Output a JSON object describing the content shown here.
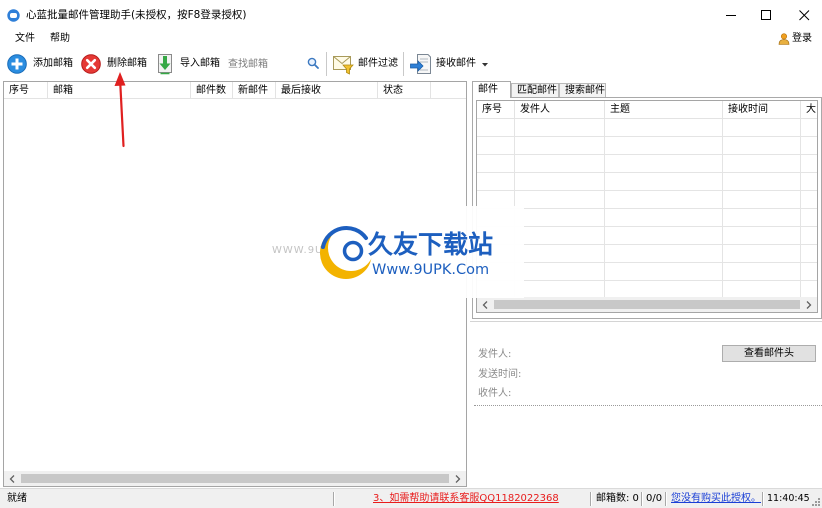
{
  "window": {
    "title": "心蓝批量邮件管理助手(未授权，按F8登录授权)",
    "app_icon": "app-icon",
    "controls": [
      "minimize-icon",
      "maximize-icon",
      "close-icon"
    ]
  },
  "menu": {
    "items": [
      {
        "label": "文件"
      },
      {
        "label": "帮助"
      }
    ],
    "login": {
      "label": "登录",
      "icon": "user-icon"
    }
  },
  "toolbar": {
    "add": {
      "label": "添加邮箱",
      "icon": "add-circle-icon"
    },
    "delete": {
      "label": "删除邮箱",
      "icon": "delete-circle-icon"
    },
    "import": {
      "label": "导入邮箱",
      "icon": "import-icon"
    },
    "search": {
      "placeholder": "查找邮箱",
      "value": "",
      "icon": "search-icon"
    },
    "filter": {
      "label": "邮件过滤",
      "icon": "mail-filter-icon"
    },
    "receive": {
      "label": "接收邮件",
      "icon": "receive-mail-icon",
      "has_dropdown": true
    }
  },
  "mailbox_list": {
    "columns": [
      "序号",
      "邮箱",
      "邮件数",
      "新邮件",
      "最后接收",
      "状态"
    ],
    "rows": []
  },
  "mail_panel": {
    "tabs": [
      {
        "label": "邮件",
        "selected": true
      },
      {
        "label": "匹配邮件",
        "selected": false
      },
      {
        "label": "搜索邮件",
        "selected": false
      }
    ],
    "columns": [
      "序号",
      "发件人",
      "主题",
      "接收时间",
      "大"
    ],
    "rows": []
  },
  "preview": {
    "view_header_button": "查看邮件头",
    "fields": [
      {
        "label": "发件人:",
        "value": ""
      },
      {
        "label": "发送时间:",
        "value": ""
      },
      {
        "label": "收件人:",
        "value": ""
      }
    ]
  },
  "statusbar": {
    "status": "就绪",
    "help_link": "3、如需帮助请联系客服QQ1182022368",
    "mailbox_count": "邮箱数: 0",
    "progress": "0/0",
    "license_link": "您没有购买此授权。",
    "time": "11:40:45"
  },
  "watermark": {
    "brand": "久友下载站",
    "url": "Www.9UPK.Com",
    "faded_url": "WWW.9UPK.com"
  },
  "annotation": {
    "icon": "red-arrow-icon"
  },
  "colors": {
    "annotation_arrow": "#e02020",
    "help_link": "#e81c1c",
    "license_link": "#1a3fd6",
    "watermark_blue": "#1d5fbf",
    "watermark_gold": "#f3b300",
    "add_icon": "#2b8de0",
    "delete_icon": "#e53935"
  }
}
